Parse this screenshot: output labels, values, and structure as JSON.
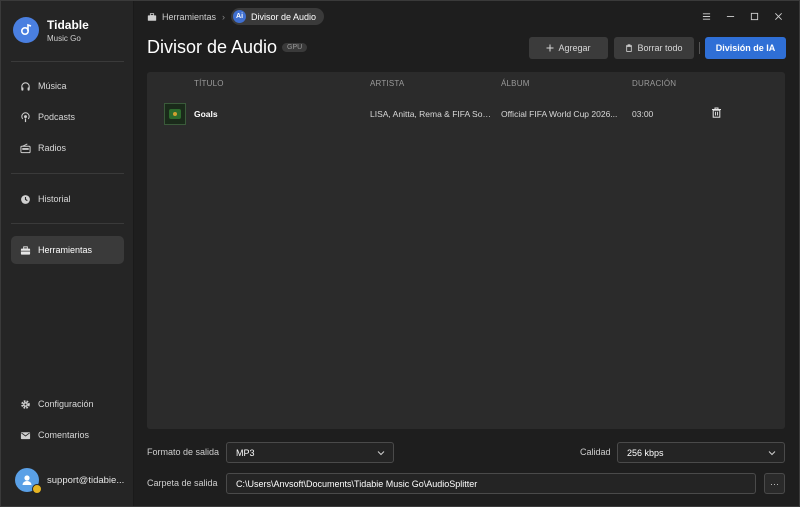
{
  "app": {
    "name": "Tidable",
    "subtitle": "Music Go"
  },
  "sidebar": {
    "items": [
      {
        "label": "Música",
        "icon": "headphones-icon"
      },
      {
        "label": "Podcasts",
        "icon": "podcast-icon"
      },
      {
        "label": "Radios",
        "icon": "radio-icon"
      },
      {
        "label": "Historial",
        "icon": "clock-icon"
      },
      {
        "label": "Herramientas",
        "icon": "toolbox-icon",
        "active": true
      },
      {
        "label": "Configuración",
        "icon": "gear-icon"
      },
      {
        "label": "Comentarios",
        "icon": "mail-icon"
      }
    ],
    "account_email": "support@tidabie..."
  },
  "breadcrumb": {
    "home": "Herramientas",
    "current": "Divisor de Audio",
    "current_icon_text": "Ai"
  },
  "page": {
    "title": "Divisor de Audio",
    "badge": "GPU"
  },
  "toolbar": {
    "add_label": "Agregar",
    "clear_label": "Borrar todo",
    "ai_label": "División de IA"
  },
  "table": {
    "columns": [
      "TÍTULO",
      "ARTISTA",
      "ÁLBUM",
      "DURACIÓN"
    ],
    "rows": [
      {
        "title": "Goals",
        "artist": "LISA, Anitta, Rema & FIFA Sou...",
        "album": "Official FIFA World Cup 2026...",
        "duration": "03:00"
      }
    ]
  },
  "form": {
    "format_label": "Formato de salida",
    "format_value": "MP3",
    "quality_label": "Calidad",
    "quality_value": "256 kbps",
    "folder_label": "Carpeta de salida",
    "folder_value": "C:\\Users\\Anvsoft\\Documents\\Tidabie Music Go\\AudioSplitter",
    "more_label": "···"
  },
  "colors": {
    "accent": "#2f6fd6",
    "background": "#1e1e1e",
    "panel": "#2b2b2b",
    "sidebar": "#252525"
  }
}
